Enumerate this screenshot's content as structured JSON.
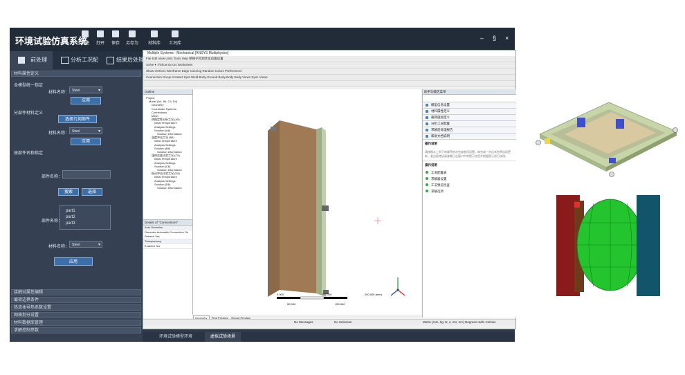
{
  "app": {
    "title": "环境试验仿真系统",
    "window_controls": [
      "–",
      "§",
      "×"
    ]
  },
  "toolbar": [
    {
      "label": "新建",
      "icon": "new-icon"
    },
    {
      "label": "打开",
      "icon": "open-icon"
    },
    {
      "label": "保存",
      "icon": "save-icon"
    },
    {
      "label": "另存为",
      "icon": "save-as-icon"
    },
    {
      "label": "材料库",
      "icon": "material-library-icon"
    },
    {
      "label": "工况库",
      "icon": "condition-library-icon"
    }
  ],
  "main_tabs": [
    "前处理",
    "分析工况配置",
    "结果后处理"
  ],
  "sidebar": {
    "section_title": "材料属性定义",
    "whole_label": "全模型统一指定",
    "material_name_label": "材料名称：",
    "material_value": "Steel",
    "apply": "应用",
    "by_part_label": "分部件材料定义",
    "select_geometry": "选择几何部件",
    "by_name_label": "按部件名称指定",
    "part_name_label": "部件名称：",
    "search": "搜索",
    "select": "选择",
    "part_list_label": "部件名称：",
    "parts": [
      "part1",
      "part2",
      "part3"
    ],
    "sections": [
      "接触对属性编辑",
      "载荷边界条件",
      "热流体导热系数设置",
      "网格划分设置",
      "材料数据库管理",
      "求解控制参数"
    ]
  },
  "bottom_tabs": [
    "环境试验模型环境",
    "虚拟试验场景"
  ],
  "ansys": {
    "title": "Multiple Systems - Mechanical [ANSYS Multiphysics]",
    "menu": "File  Edit  View  Units  Tools  Help  绝缘子风洞优化前置设置",
    "toolbar1": "Solve ▾  ?/Show Errors  Worksheet",
    "toolbar2": "Show Vertices  Wireframe  Edge Coloring  Random Colors  Preferences",
    "toolbar3": "Connection Group  Contact  Spot Weld  Body-Ground  Body-Body  Body Views  Sync Views",
    "outline_title": "Outline",
    "tree": [
      "Project",
      "Model (A4, B4, C4, D4)",
      "Geometry",
      "Coordinate Systems",
      "Connections",
      "Mesh",
      "热稳定性分析工况 (A5)",
      "Initial Temperature",
      "Analysis Settings",
      "Solution (A6)",
      "Solution Information",
      "温度冲击工况 (B5)",
      "Initial Temperature",
      "Analysis Settings",
      "Solution (B6)",
      "Solution Information",
      "湿热交变试验工况 (C5)",
      "Initial Temperature",
      "Analysis Settings",
      "Solution (C6)",
      "Solution Information",
      "振动冲击试验工况 (D5)",
      "Initial Temperature",
      "Analysis Settings",
      "Solution (D6)",
      "Solution Information"
    ],
    "details_title": "Details of \"Connections\"",
    "details": [
      "Auto Detection",
      "Generate Automatic Connection On Refresh  Yes",
      "Transparency",
      "Enabled  Yes"
    ],
    "right_title": "助手功能区菜单",
    "right_items": [
      "模型信息设置",
      "材料属性定义",
      "载荷施加定义",
      "分析工况配置",
      "求解后处理报告",
      "帮助文档说明"
    ],
    "right_text_title": "操作说明",
    "right_text": "请按照从上到下的顺序依次完成各项设置，每完成一步后状态将自动更新，若出现错误请查看日志窗口中的提示信息并根据提示进行修改。",
    "right_sub_title": "操作说明",
    "right_subs": [
      "工况配置表",
      "求解器设置",
      "工况预览检查",
      "求解选项"
    ],
    "graph_tabs": [
      "Geometry",
      "Print Preview",
      "Report Preview"
    ],
    "status": [
      "No Messages",
      "No Selection",
      "Metric (mm, kg, N, s, mV, mA)  Degrees  rad/s  Celsius"
    ],
    "scale": [
      "0.000",
      "100.000",
      "200.000 (mm)",
      "50.000",
      "150.000"
    ]
  }
}
